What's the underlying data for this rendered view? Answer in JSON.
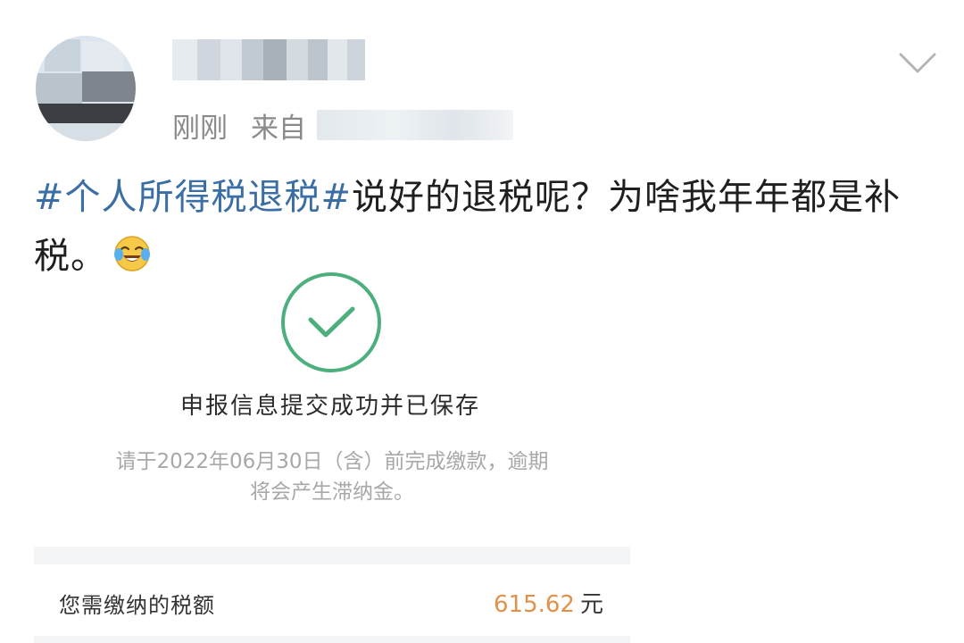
{
  "post": {
    "time": "刚刚",
    "source_prefix": "来自",
    "hashtag": "#个人所得税退税#",
    "body": "说好的退税呢？为啥我年年都是补税。",
    "emoji": "crying-laughing-emoji"
  },
  "card": {
    "icon": "check-circle-icon",
    "success_title": "申报信息提交成功并已保存",
    "notice_line1": "请于2022年06月30日（含）前完成缴款，逾期",
    "notice_line2": "将会产生滞纳金。",
    "tax_label": "您需缴纳的税额",
    "tax_amount": "615.62",
    "tax_unit": "元"
  },
  "colors": {
    "hashtag": "#3a6ea5",
    "check_green": "#4caf7d",
    "amount_orange": "#e0914a"
  }
}
